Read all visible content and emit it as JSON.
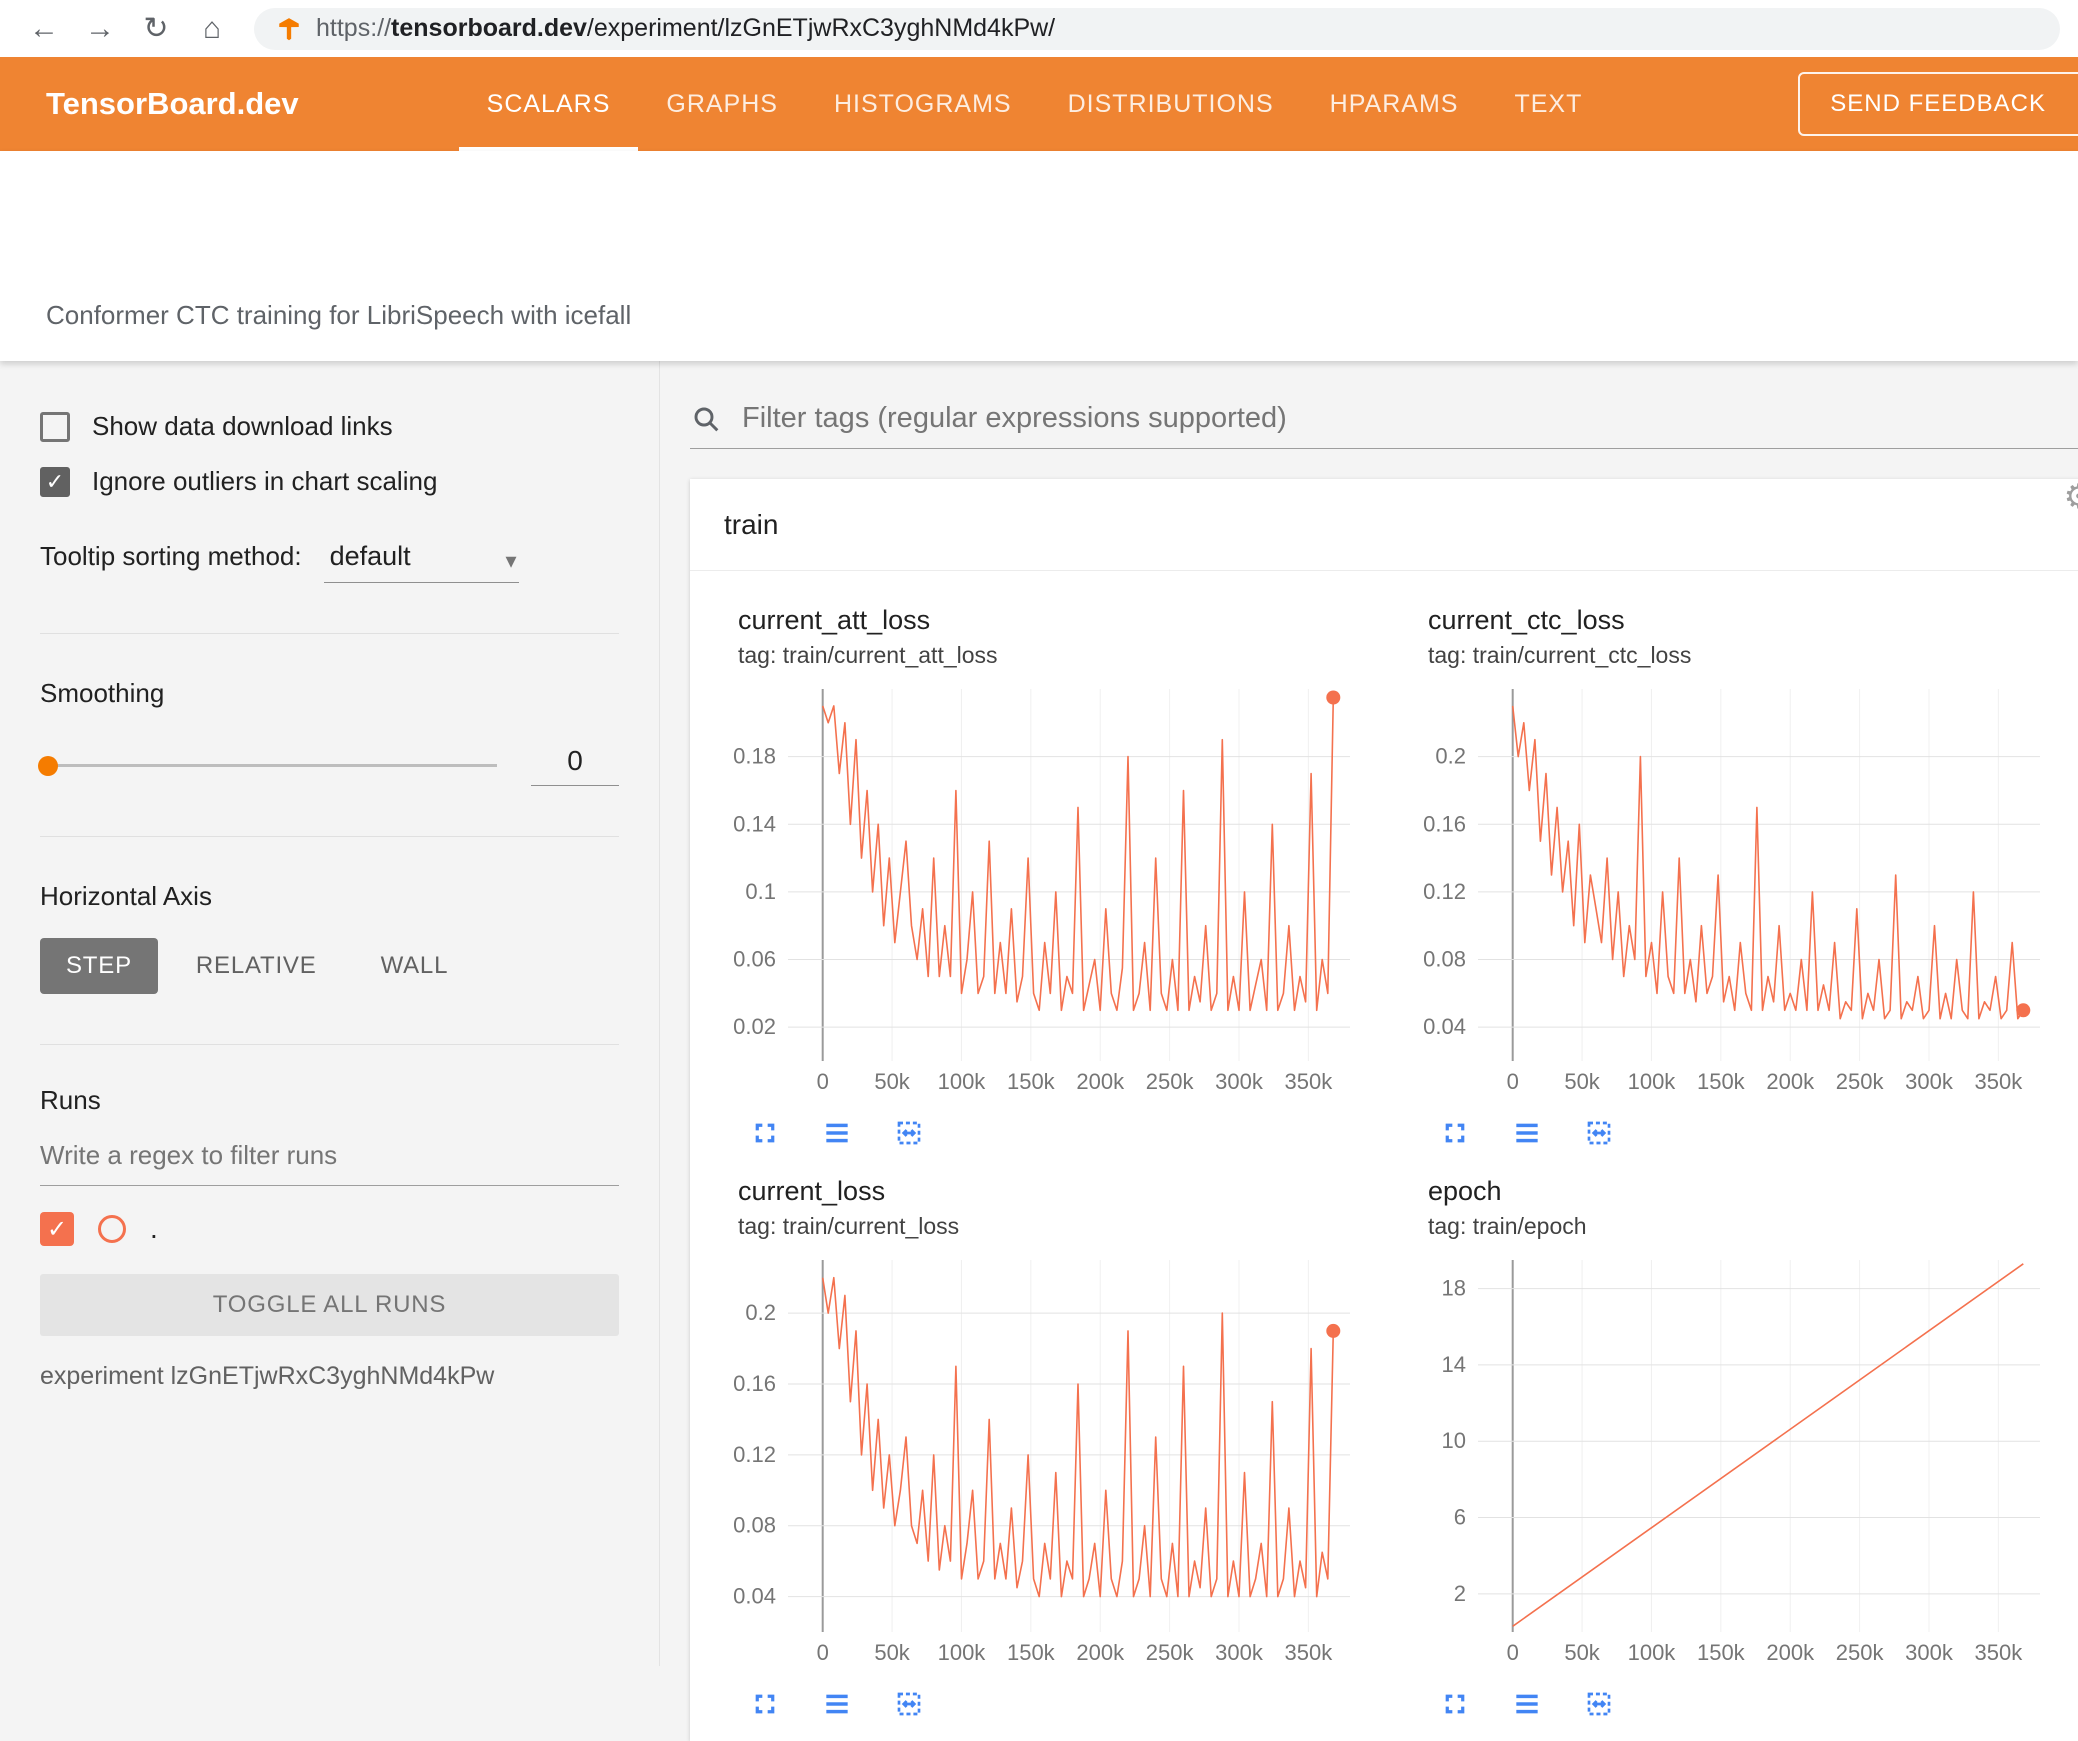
{
  "browser": {
    "url_scheme": "https://",
    "url_domain": "tensorboard.dev",
    "url_path": "/experiment/lzGnETjwRxC3yghNMd4kPw/"
  },
  "header": {
    "brand": "TensorBoard.dev",
    "tabs": [
      {
        "label": "SCALARS",
        "active": true
      },
      {
        "label": "GRAPHS",
        "active": false
      },
      {
        "label": "HISTOGRAMS",
        "active": false
      },
      {
        "label": "DISTRIBUTIONS",
        "active": false
      },
      {
        "label": "HPARAMS",
        "active": false
      },
      {
        "label": "TEXT",
        "active": false
      }
    ],
    "feedback_button": "SEND FEEDBACK"
  },
  "experiment_title": "Conformer CTC training for LibriSpeech with icefall",
  "sidebar": {
    "show_download_label": "Show data download links",
    "show_download_checked": false,
    "ignore_outliers_label": "Ignore outliers in chart scaling",
    "ignore_outliers_checked": true,
    "tooltip_sorting_label": "Tooltip sorting method:",
    "tooltip_sorting_value": "default",
    "smoothing_label": "Smoothing",
    "smoothing_value": "0",
    "horizontal_axis_label": "Horizontal Axis",
    "axis_options": [
      {
        "label": "STEP",
        "selected": true
      },
      {
        "label": "RELATIVE",
        "selected": false
      },
      {
        "label": "WALL",
        "selected": false
      }
    ],
    "runs_label": "Runs",
    "runs_filter_placeholder": "Write a regex to filter runs",
    "run_item_label": ".",
    "run_checked": true,
    "toggle_all_label": "TOGGLE ALL RUNS",
    "experiment_line": "experiment lzGnETjwRxC3yghNMd4kPw"
  },
  "main": {
    "filter_placeholder": "Filter tags (regular expressions supported)",
    "group_label": "train"
  },
  "colors": {
    "header_orange": "#ef8432",
    "series": "#f4714e",
    "accent_orange": "#f57c00",
    "icon_blue": "#4285f4"
  },
  "chart_data": [
    {
      "type": "line",
      "title": "current_att_loss",
      "tag": "tag: train/current_att_loss",
      "xlabel": "step",
      "xlim": [
        -25000,
        380000
      ],
      "x_ticks": [
        0,
        50000,
        100000,
        150000,
        200000,
        250000,
        300000,
        350000
      ],
      "x_tick_labels": [
        "0",
        "50k",
        "100k",
        "150k",
        "200k",
        "250k",
        "300k",
        "350k"
      ],
      "ylim": [
        0.0,
        0.22
      ],
      "y_ticks": [
        0.02,
        0.06,
        0.1,
        0.14,
        0.18
      ],
      "y_tick_labels": [
        "0.02",
        "0.06",
        "0.1",
        "0.14",
        "0.18"
      ],
      "x_step": 4000,
      "end_dot": true,
      "values": [
        0.21,
        0.2,
        0.21,
        0.17,
        0.2,
        0.14,
        0.19,
        0.12,
        0.16,
        0.1,
        0.14,
        0.08,
        0.12,
        0.07,
        0.1,
        0.13,
        0.08,
        0.06,
        0.09,
        0.05,
        0.12,
        0.05,
        0.08,
        0.05,
        0.16,
        0.04,
        0.06,
        0.1,
        0.04,
        0.05,
        0.13,
        0.04,
        0.07,
        0.04,
        0.09,
        0.035,
        0.05,
        0.12,
        0.04,
        0.03,
        0.07,
        0.04,
        0.1,
        0.03,
        0.05,
        0.04,
        0.15,
        0.03,
        0.045,
        0.06,
        0.03,
        0.09,
        0.04,
        0.03,
        0.055,
        0.18,
        0.03,
        0.04,
        0.07,
        0.03,
        0.12,
        0.04,
        0.03,
        0.06,
        0.03,
        0.16,
        0.03,
        0.05,
        0.035,
        0.08,
        0.03,
        0.04,
        0.19,
        0.03,
        0.05,
        0.03,
        0.1,
        0.03,
        0.045,
        0.06,
        0.03,
        0.14,
        0.03,
        0.04,
        0.08,
        0.03,
        0.05,
        0.035,
        0.17,
        0.03,
        0.06,
        0.04,
        0.215
      ]
    },
    {
      "type": "line",
      "title": "current_ctc_loss",
      "tag": "tag: train/current_ctc_loss",
      "xlabel": "step",
      "xlim": [
        -25000,
        380000
      ],
      "x_ticks": [
        0,
        50000,
        100000,
        150000,
        200000,
        250000,
        300000,
        350000
      ],
      "x_tick_labels": [
        "0",
        "50k",
        "100k",
        "150k",
        "200k",
        "250k",
        "300k",
        "350k"
      ],
      "ylim": [
        0.02,
        0.24
      ],
      "y_ticks": [
        0.04,
        0.08,
        0.12,
        0.16,
        0.2
      ],
      "y_tick_labels": [
        "0.04",
        "0.08",
        "0.12",
        "0.16",
        "0.2"
      ],
      "x_step": 4000,
      "end_dot": true,
      "values": [
        0.23,
        0.2,
        0.22,
        0.18,
        0.21,
        0.15,
        0.19,
        0.13,
        0.17,
        0.12,
        0.15,
        0.1,
        0.16,
        0.09,
        0.13,
        0.11,
        0.09,
        0.14,
        0.08,
        0.12,
        0.07,
        0.1,
        0.08,
        0.2,
        0.07,
        0.09,
        0.06,
        0.12,
        0.07,
        0.06,
        0.14,
        0.06,
        0.08,
        0.055,
        0.1,
        0.06,
        0.07,
        0.13,
        0.055,
        0.07,
        0.05,
        0.09,
        0.06,
        0.05,
        0.17,
        0.05,
        0.07,
        0.055,
        0.1,
        0.05,
        0.06,
        0.05,
        0.08,
        0.05,
        0.12,
        0.05,
        0.065,
        0.05,
        0.09,
        0.045,
        0.055,
        0.05,
        0.11,
        0.045,
        0.06,
        0.05,
        0.08,
        0.045,
        0.05,
        0.13,
        0.045,
        0.055,
        0.05,
        0.07,
        0.045,
        0.05,
        0.1,
        0.045,
        0.06,
        0.045,
        0.08,
        0.05,
        0.045,
        0.12,
        0.045,
        0.055,
        0.05,
        0.07,
        0.045,
        0.05,
        0.09,
        0.045,
        0.05
      ]
    },
    {
      "type": "line",
      "title": "current_loss",
      "tag": "tag: train/current_loss",
      "xlabel": "step",
      "xlim": [
        -25000,
        380000
      ],
      "x_ticks": [
        0,
        50000,
        100000,
        150000,
        200000,
        250000,
        300000,
        350000
      ],
      "x_tick_labels": [
        "0",
        "50k",
        "100k",
        "150k",
        "200k",
        "250k",
        "300k",
        "350k"
      ],
      "ylim": [
        0.02,
        0.23
      ],
      "y_ticks": [
        0.04,
        0.08,
        0.12,
        0.16,
        0.2
      ],
      "y_tick_labels": [
        "0.04",
        "0.08",
        "0.12",
        "0.16",
        "0.2"
      ],
      "x_step": 4000,
      "end_dot": true,
      "values": [
        0.22,
        0.2,
        0.22,
        0.18,
        0.21,
        0.15,
        0.19,
        0.12,
        0.16,
        0.1,
        0.14,
        0.09,
        0.12,
        0.08,
        0.1,
        0.13,
        0.08,
        0.07,
        0.1,
        0.06,
        0.12,
        0.055,
        0.08,
        0.06,
        0.17,
        0.05,
        0.07,
        0.1,
        0.05,
        0.06,
        0.14,
        0.05,
        0.07,
        0.05,
        0.09,
        0.045,
        0.06,
        0.12,
        0.05,
        0.04,
        0.07,
        0.05,
        0.11,
        0.04,
        0.06,
        0.05,
        0.16,
        0.04,
        0.05,
        0.07,
        0.04,
        0.1,
        0.05,
        0.04,
        0.06,
        0.19,
        0.04,
        0.05,
        0.08,
        0.04,
        0.13,
        0.05,
        0.04,
        0.07,
        0.04,
        0.17,
        0.04,
        0.06,
        0.045,
        0.09,
        0.04,
        0.05,
        0.2,
        0.04,
        0.06,
        0.04,
        0.11,
        0.04,
        0.05,
        0.07,
        0.04,
        0.15,
        0.04,
        0.05,
        0.09,
        0.04,
        0.06,
        0.045,
        0.18,
        0.04,
        0.065,
        0.05,
        0.19
      ]
    },
    {
      "type": "line",
      "title": "epoch",
      "tag": "tag: train/epoch",
      "xlabel": "step",
      "xlim": [
        -25000,
        380000
      ],
      "x_ticks": [
        0,
        50000,
        100000,
        150000,
        200000,
        250000,
        300000,
        350000
      ],
      "x_tick_labels": [
        "0",
        "50k",
        "100k",
        "150k",
        "200k",
        "250k",
        "300k",
        "350k"
      ],
      "ylim": [
        0,
        19.5
      ],
      "y_ticks": [
        2,
        6,
        10,
        14,
        18
      ],
      "y_tick_labels": [
        "2",
        "6",
        "10",
        "14",
        "18"
      ],
      "x": [
        0,
        368000
      ],
      "end_dot": false,
      "values": [
        0.3,
        19.3
      ]
    }
  ]
}
